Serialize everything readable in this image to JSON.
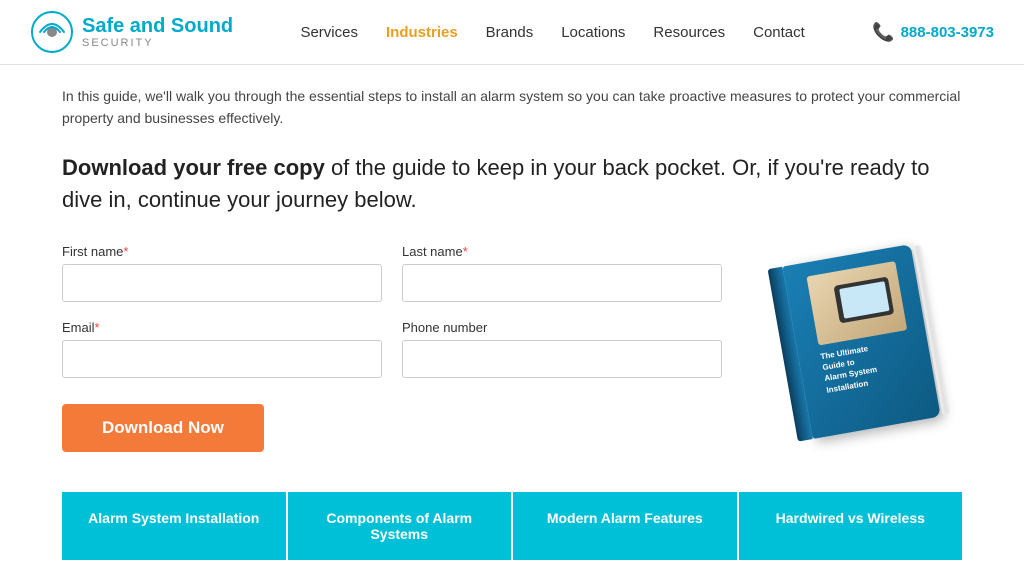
{
  "header": {
    "logo_main": "Safe and Sound",
    "logo_sub": "SECURITY",
    "nav": [
      {
        "label": "Services",
        "highlight": false
      },
      {
        "label": "Industries",
        "highlight": true
      },
      {
        "label": "Brands",
        "highlight": false
      },
      {
        "label": "Locations",
        "highlight": false
      },
      {
        "label": "Resources",
        "highlight": false
      },
      {
        "label": "Contact",
        "highlight": false
      }
    ],
    "phone": "888-803-3973"
  },
  "main": {
    "intro_text": "In this guide, we'll walk you through the essential steps to install an alarm system so you can take proactive measures to protect your commercial property and businesses effectively.",
    "cta_heading_bold": "Download your free copy",
    "cta_heading_rest": " of the guide to keep in your back pocket. Or, if you're ready to dive in, continue your journey below.",
    "form": {
      "first_name_label": "First name",
      "last_name_label": "Last name",
      "email_label": "Email",
      "phone_label": "Phone number",
      "required_marker": "*"
    },
    "download_button": "Download Now",
    "book": {
      "title_line1": "The Ultimate",
      "title_line2": "Guide to",
      "title_line3": "Alarm System",
      "title_line4": "Installation"
    }
  },
  "bottom_tabs": [
    {
      "label": "Alarm System Installation"
    },
    {
      "label": "Components of Alarm Systems"
    },
    {
      "label": "Modern Alarm Features"
    },
    {
      "label": "Hardwired vs Wireless"
    }
  ]
}
